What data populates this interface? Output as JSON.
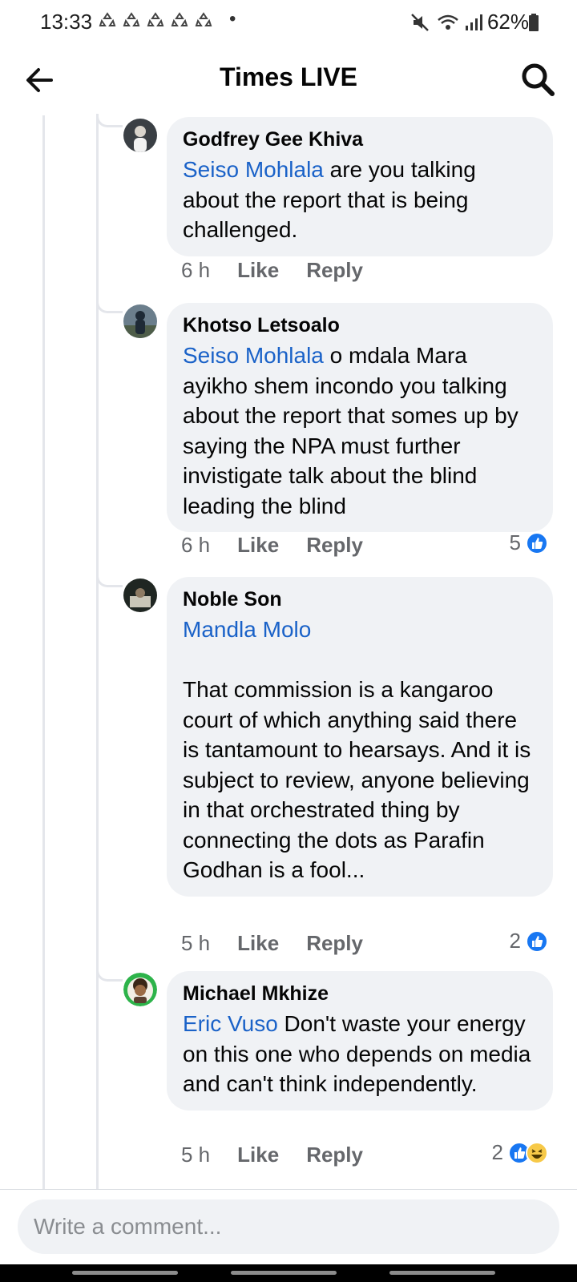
{
  "status_bar": {
    "time": "13:33",
    "battery": "62%"
  },
  "header": {
    "title": "Times LIVE"
  },
  "comments": [
    {
      "author": "Godfrey Gee Khiva",
      "mention": "Seiso Mohlala",
      "text": " are you talking about the report that is being challenged.",
      "time": "6 h",
      "like": "Like",
      "reply": "Reply",
      "reactions": ""
    },
    {
      "author": "Khotso Letsoalo",
      "mention": "Seiso Mohlala",
      "text": " o mdala Mara ayikho shem incondo you talking about the report that somes up by saying the NPA must further invistigate talk about the blind leading the blind",
      "time": "6 h",
      "like": "Like",
      "reply": "Reply",
      "reactions": "5"
    },
    {
      "author": "Noble Son",
      "mention": "Mandla Molo",
      "text": "\n\nThat commission is a kangaroo court of which anything said there is tantamount to hearsays. And it is subject to review, anyone believing in that orchestrated thing by connecting the dots as Parafin Godhan is a fool...",
      "time": "5 h",
      "like": "Like",
      "reply": "Reply",
      "reactions": "2"
    },
    {
      "author": "Michael Mkhize",
      "mention": "Eric Vuso",
      "text": " Don't waste your energy on this one who depends on media and can't think independently.",
      "time": "5 h",
      "like": "Like",
      "reply": "Reply",
      "reactions": "2"
    }
  ],
  "composer": {
    "placeholder": "Write a comment..."
  },
  "colors": {
    "mention": "#1a62c8",
    "bubble": "#f0f2f5",
    "like_blue": "#1877f2"
  },
  "icons": [
    "back-arrow-icon",
    "search-icon",
    "like-reaction-icon",
    "haha-reaction-icon",
    "mute-icon",
    "wifi-icon",
    "signal-icon",
    "battery-icon"
  ]
}
